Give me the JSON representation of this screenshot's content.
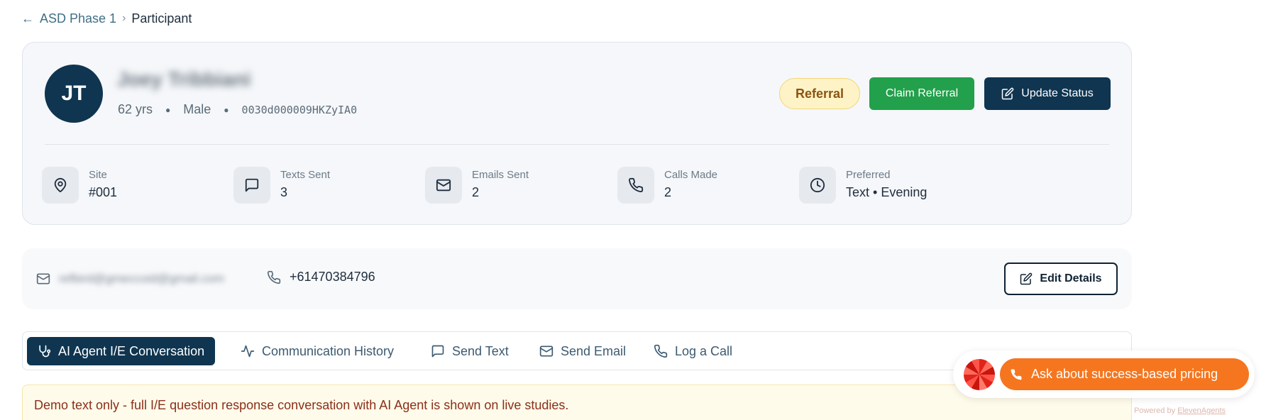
{
  "breadcrumb": {
    "parent": "ASD Phase 1",
    "current": "Participant"
  },
  "participant": {
    "initials": "JT",
    "name": "Joey Tribbiani",
    "age": "62 yrs",
    "gender": "Male",
    "record_id": "0030d000009HKZyIA0",
    "status_badge": "Referral",
    "claim_label": "Claim Referral",
    "update_label": "Update Status"
  },
  "stats": [
    {
      "label": "Site",
      "value": "#001",
      "icon": "map-pin-icon"
    },
    {
      "label": "Texts Sent",
      "value": "3",
      "icon": "message-icon"
    },
    {
      "label": "Emails Sent",
      "value": "2",
      "icon": "mail-icon"
    },
    {
      "label": "Calls Made",
      "value": "2",
      "icon": "phone-icon"
    },
    {
      "label": "Preferred",
      "value": "Text • Evening",
      "icon": "clock-icon"
    }
  ],
  "contact": {
    "email": "refbird@gmeccoid@gmail.com",
    "phone": "+61470384796",
    "edit_label": "Edit Details"
  },
  "tabs": [
    {
      "label": "AI Agent I/E Conversation",
      "icon": "stethoscope-icon",
      "active": true
    },
    {
      "label": "Communication History",
      "icon": "activity-icon",
      "active": false
    },
    {
      "label": "Send Text",
      "icon": "message-icon",
      "active": false
    },
    {
      "label": "Send Email",
      "icon": "mail-icon",
      "active": false
    },
    {
      "label": "Log a Call",
      "icon": "phone-icon",
      "active": false
    }
  ],
  "notice": "Demo text only - full I/E question response conversation with AI Agent is shown on live studies.",
  "widget": {
    "cta_label": "Ask about success-based pricing",
    "powered_prefix": "Powered by",
    "powered_brand": "ElevenAgents"
  },
  "colors": {
    "primary": "#0f3550",
    "claim": "#22a04b",
    "badge_bg": "#fdf3c6",
    "cta": "#f5761f",
    "notice_text": "#8a2f1a"
  }
}
